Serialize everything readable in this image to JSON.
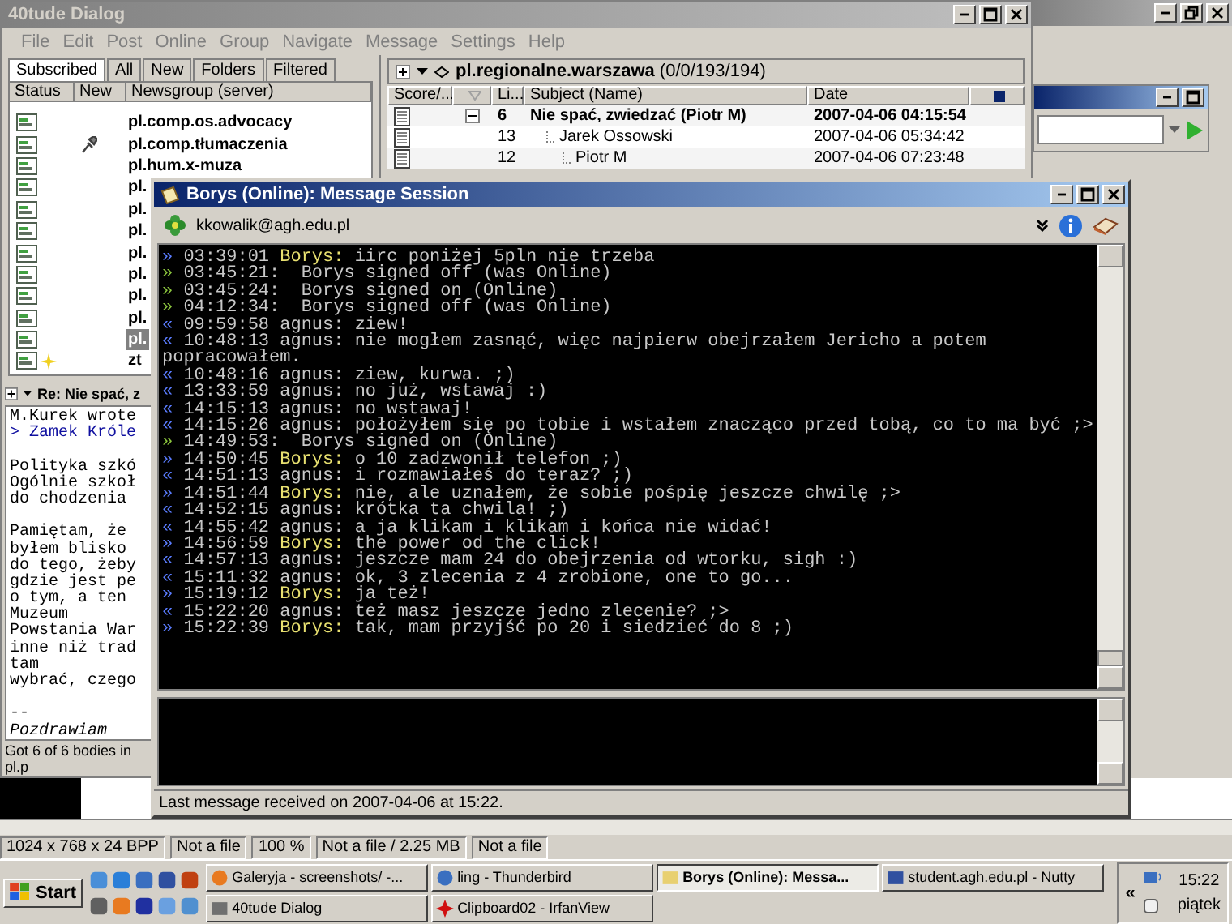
{
  "main_window": {
    "title": "40tude Dialog",
    "menu": [
      "File",
      "Edit",
      "Post",
      "Online",
      "Group",
      "Navigate",
      "Message",
      "Settings",
      "Help"
    ]
  },
  "newsgroups": {
    "tabs": [
      {
        "label": "Subscribed",
        "selected": true
      },
      {
        "label": "All",
        "selected": false
      },
      {
        "label": "New",
        "selected": false
      },
      {
        "label": "Folders",
        "selected": false
      },
      {
        "label": "Filtered",
        "selected": false
      }
    ],
    "columns": [
      "Status",
      "New",
      "Newsgroup (server)"
    ],
    "rows": [
      {
        "name": "pl.comp.os.advocacy",
        "pinned": false,
        "starred": false,
        "selected": false
      },
      {
        "name": "pl.comp.tłumaczenia",
        "pinned": true,
        "starred": false,
        "selected": false
      },
      {
        "name": "pl.hum.x-muza",
        "pinned": false,
        "starred": false,
        "selected": false
      },
      {
        "name": "pl.",
        "pinned": false,
        "starred": false,
        "selected": false
      },
      {
        "name": "pl.",
        "pinned": false,
        "starred": false,
        "selected": false
      },
      {
        "name": "pl.",
        "pinned": false,
        "starred": false,
        "selected": false
      },
      {
        "name": "pl.",
        "pinned": false,
        "starred": false,
        "selected": false
      },
      {
        "name": "pl.",
        "pinned": false,
        "starred": false,
        "selected": false
      },
      {
        "name": "pl.",
        "pinned": false,
        "starred": false,
        "selected": false
      },
      {
        "name": "pl.",
        "pinned": false,
        "starred": false,
        "selected": false
      },
      {
        "name": "pl.",
        "pinned": false,
        "starred": false,
        "selected": true
      },
      {
        "name": "zt",
        "pinned": false,
        "starred": true,
        "selected": false
      }
    ]
  },
  "article_pane": {
    "title": "Re: Nie spać, z",
    "lines": [
      {
        "kind": "text",
        "text": "M.Kurek wrote"
      },
      {
        "kind": "quote",
        "text": "> Zamek Króle"
      },
      {
        "kind": "blank"
      },
      {
        "kind": "text",
        "text": "Polityka szkó"
      },
      {
        "kind": "text",
        "text": "Ogólnie szkoł"
      },
      {
        "kind": "text",
        "text": "do chodzenia"
      },
      {
        "kind": "blank"
      },
      {
        "kind": "text",
        "text": "Pamiętam, że"
      },
      {
        "kind": "text",
        "text": "byłem blisko"
      },
      {
        "kind": "text",
        "text": "do tego, żeby"
      },
      {
        "kind": "text",
        "text": "gdzie jest pe"
      },
      {
        "kind": "text",
        "text": "o tym, a ten"
      },
      {
        "kind": "text",
        "text": "Muzeum"
      },
      {
        "kind": "text",
        "text": "Powstania War"
      },
      {
        "kind": "text",
        "text": "inne niż trad"
      },
      {
        "kind": "text",
        "text": "tam"
      },
      {
        "kind": "text",
        "text": "wybrać, czego"
      },
      {
        "kind": "blank"
      },
      {
        "kind": "text",
        "text": "--"
      },
      {
        "kind": "signature",
        "text": "Pozdrawiam"
      }
    ],
    "status": "Got 6 of 6 bodies in pl.p"
  },
  "thread_pane": {
    "group": "**pl.regionalne.warszawa** (0/0/193/194)",
    "columns": {
      "score": "Score/...",
      "lines": "Li...",
      "subject": "Subject (Name)",
      "date": "Date"
    },
    "rows": [
      {
        "lines": "6",
        "subject": "Nie spać, zwiedzać (Piotr M)",
        "date": "2007-04-06 04:15:54",
        "unread": true,
        "expanded": true,
        "children": [
          {
            "lines": "13",
            "subject": "Jarek Ossowski",
            "date": "2007-04-06 05:34:42",
            "unread": false,
            "children": [
              {
                "lines": "12",
                "subject": "Piotr M",
                "date": "2007-04-06 07:23:48",
                "unread": false
              }
            ]
          }
        ]
      }
    ]
  },
  "chat_window": {
    "title": "Borys (Online): Message Session",
    "contact": "kkowalik@agh.edu.pl",
    "messages": [
      {
        "kind": "received",
        "arrow": "»",
        "time": "03:39:01",
        "sender": "Borys:",
        "text": "iirc poniżej 5pln nie trzeba"
      },
      {
        "kind": "status",
        "arrow": "»",
        "time": "03:45:21:",
        "text": "Borys signed off (was Online)"
      },
      {
        "kind": "status",
        "arrow": "»",
        "time": "03:45:24:",
        "text": "Borys signed on (Online)"
      },
      {
        "kind": "status",
        "arrow": "»",
        "time": "04:12:34:",
        "text": "Borys signed off (was Online)"
      },
      {
        "kind": "sent",
        "arrow": "«",
        "time": "09:59:58",
        "sender": "agnus:",
        "text": "ziew!"
      },
      {
        "kind": "sent",
        "arrow": "«",
        "time": "10:48:13",
        "sender": "agnus:",
        "text": "nie mogłem zasnąć, więc najpierw obejrzałem Jericho a potem popracowałem."
      },
      {
        "kind": "sent",
        "arrow": "«",
        "time": "10:48:16",
        "sender": "agnus:",
        "text": "ziew, kurwa. ;)"
      },
      {
        "kind": "sent",
        "arrow": "«",
        "time": "13:33:59",
        "sender": "agnus:",
        "text": "no już, wstawaj :)"
      },
      {
        "kind": "sent",
        "arrow": "«",
        "time": "14:15:13",
        "sender": "agnus:",
        "text": "no wstawaj!"
      },
      {
        "kind": "sent",
        "arrow": "«",
        "time": "14:15:26",
        "sender": "agnus:",
        "text": "położyłem się po tobie i wstałem znacząco przed tobą, co to ma być ;>"
      },
      {
        "kind": "status",
        "arrow": "»",
        "time": "14:49:53:",
        "text": "Borys signed on (Online)"
      },
      {
        "kind": "received",
        "arrow": "»",
        "time": "14:50:45",
        "sender": "Borys:",
        "text": "o 10 zadzwonił telefon ;)"
      },
      {
        "kind": "sent",
        "arrow": "«",
        "time": "14:51:13",
        "sender": "agnus:",
        "text": "i rozmawiałeś do teraz? ;)"
      },
      {
        "kind": "received",
        "arrow": "»",
        "time": "14:51:44",
        "sender": "Borys:",
        "text": "nie, ale uznałem, że sobie pośpię jeszcze chwilę ;>"
      },
      {
        "kind": "sent",
        "arrow": "«",
        "time": "14:52:15",
        "sender": "agnus:",
        "text": "krótka ta chwila! ;)"
      },
      {
        "kind": "sent",
        "arrow": "«",
        "time": "14:55:42",
        "sender": "agnus:",
        "text": "a ja klikam i klikam i końca nie widać!"
      },
      {
        "kind": "received",
        "arrow": "»",
        "time": "14:56:59",
        "sender": "Borys:",
        "text": "the power od the click!"
      },
      {
        "kind": "sent",
        "arrow": "«",
        "time": "14:57:13",
        "sender": "agnus:",
        "text": "jeszcze mam 24 do obejrzenia od wtorku, sigh :)"
      },
      {
        "kind": "sent",
        "arrow": "«",
        "time": "15:11:32",
        "sender": "agnus:",
        "text": "ok, 3 zlecenia z 4 zrobione, one to go..."
      },
      {
        "kind": "received",
        "arrow": "»",
        "time": "15:19:12",
        "sender": "Borys:",
        "text": "ja też!"
      },
      {
        "kind": "sent",
        "arrow": "«",
        "time": "15:22:20",
        "sender": "agnus:",
        "text": "też masz jeszcze jedno zlecenie? ;>"
      },
      {
        "kind": "received",
        "arrow": "»",
        "time": "15:22:39",
        "sender": "Borys:",
        "text": "tak, mam przyjść po 20 i siedzieć do 8 ;)"
      }
    ],
    "status": "Last message received on 2007-04-06 at 15:22."
  },
  "viewer_status": [
    "1024 x 768 x 24 BPP",
    "Not a file",
    "100 %",
    "Not a file / 2.25 MB",
    "Not a file"
  ],
  "taskbar": {
    "start": "Start",
    "tasks": [
      {
        "label": "Galeryja - screenshots/ -...",
        "kind": "globe",
        "selected": false
      },
      {
        "label": "ling - Thunderbird",
        "kind": "mail",
        "selected": false
      },
      {
        "label": "Borys (Online): Messa...",
        "kind": "note",
        "selected": true
      },
      {
        "label": "student.agh.edu.pl - Nutty",
        "kind": "network",
        "selected": false
      },
      {
        "label": "40tude Dialog",
        "kind": "news",
        "selected": false
      },
      {
        "label": "Clipboard02 - IrfanView",
        "kind": "splat",
        "selected": false
      }
    ],
    "tray_toggle": "«",
    "clock": "15:22",
    "day": "piątek"
  }
}
